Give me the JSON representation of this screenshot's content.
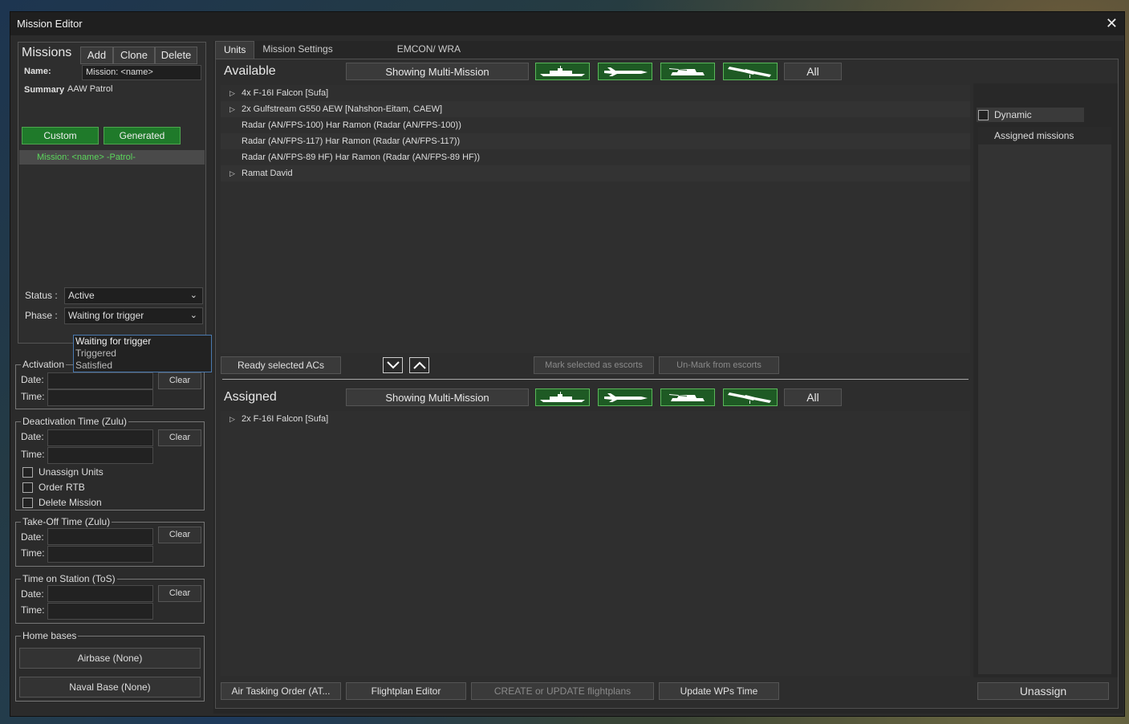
{
  "window": {
    "title": "Mission Editor",
    "close_glyph": "✕"
  },
  "missions": {
    "title": "Missions",
    "add_label": "Add",
    "clone_label": "Clone",
    "delete_label": "Delete",
    "name_label": "Name:",
    "name_value": "Mission: <name>",
    "summary_label": "Summary",
    "summary_value": "AAW Patrol",
    "custom_label": "Custom",
    "generated_label": "Generated",
    "list": [
      "Mission: <name> -Patrol-"
    ]
  },
  "status": {
    "label": "Status :",
    "value": "Active"
  },
  "phase": {
    "label": "Phase :",
    "value": "Waiting for trigger",
    "options": [
      "Waiting for trigger",
      "Triggered",
      "Satisfied"
    ]
  },
  "activation": {
    "title": "Activation",
    "date_label": "Date:",
    "time_label": "Time:",
    "clear_label": "Clear"
  },
  "deactivation": {
    "title": "Deactivation Time (Zulu)",
    "date_label": "Date:",
    "time_label": "Time:",
    "clear_label": "Clear",
    "options": [
      "Unassign Units",
      "Order RTB",
      "Delete Mission"
    ]
  },
  "takeoff": {
    "title": "Take-Off Time (Zulu)",
    "date_label": "Date:",
    "time_label": "Time:",
    "clear_label": "Clear"
  },
  "tos": {
    "title": "Time on Station (ToS)",
    "date_label": "Date:",
    "time_label": "Time:",
    "clear_label": "Clear"
  },
  "home_bases": {
    "title": "Home bases",
    "airbase": "Airbase (None)",
    "naval": "Naval Base (None)"
  },
  "tabs": [
    "Units",
    "Mission Settings",
    "EMCON/ WRA"
  ],
  "available": {
    "title": "Available",
    "showing": "Showing Multi-Mission",
    "all_label": "All",
    "units": [
      {
        "label": "4x F-16I Falcon [Sufa]",
        "expandable": true
      },
      {
        "label": "2x Gulfstream G550 AEW [Nahshon-Eitam, CAEW]",
        "expandable": true
      },
      {
        "label": "Radar (AN/FPS-100) Har Ramon (Radar (AN/FPS-100))",
        "expandable": false
      },
      {
        "label": "Radar (AN/FPS-117) Har Ramon (Radar (AN/FPS-117))",
        "expandable": false
      },
      {
        "label": "Radar (AN/FPS-89 HF) Har Ramon (Radar (AN/FPS-89 HF))",
        "expandable": false
      },
      {
        "label": "Ramat David",
        "expandable": true
      }
    ]
  },
  "middle_bar": {
    "ready": "Ready selected ACs",
    "mark": "Mark selected as escorts",
    "unmark": "Un-Mark from escorts"
  },
  "assigned": {
    "title": "Assigned",
    "showing": "Showing Multi-Mission",
    "all_label": "All",
    "units": [
      {
        "label": "2x F-16I Falcon [Sufa]",
        "expandable": true
      }
    ]
  },
  "side": {
    "dynamic_label": "Dynamic",
    "assigned_missions_label": "Assigned missions"
  },
  "bottom": {
    "ato": "Air Tasking Order (AT...",
    "flightplan": "Flightplan Editor",
    "create": "CREATE or UPDATE flightplans",
    "update_wps": "Update WPs Time",
    "unassign": "Unassign"
  },
  "colors": {
    "accent_green": "#1f7a2a",
    "selected_text": "#5cd65c"
  },
  "icons": [
    "ship-icon",
    "aircraft-icon",
    "tank-icon",
    "satellite-icon"
  ]
}
